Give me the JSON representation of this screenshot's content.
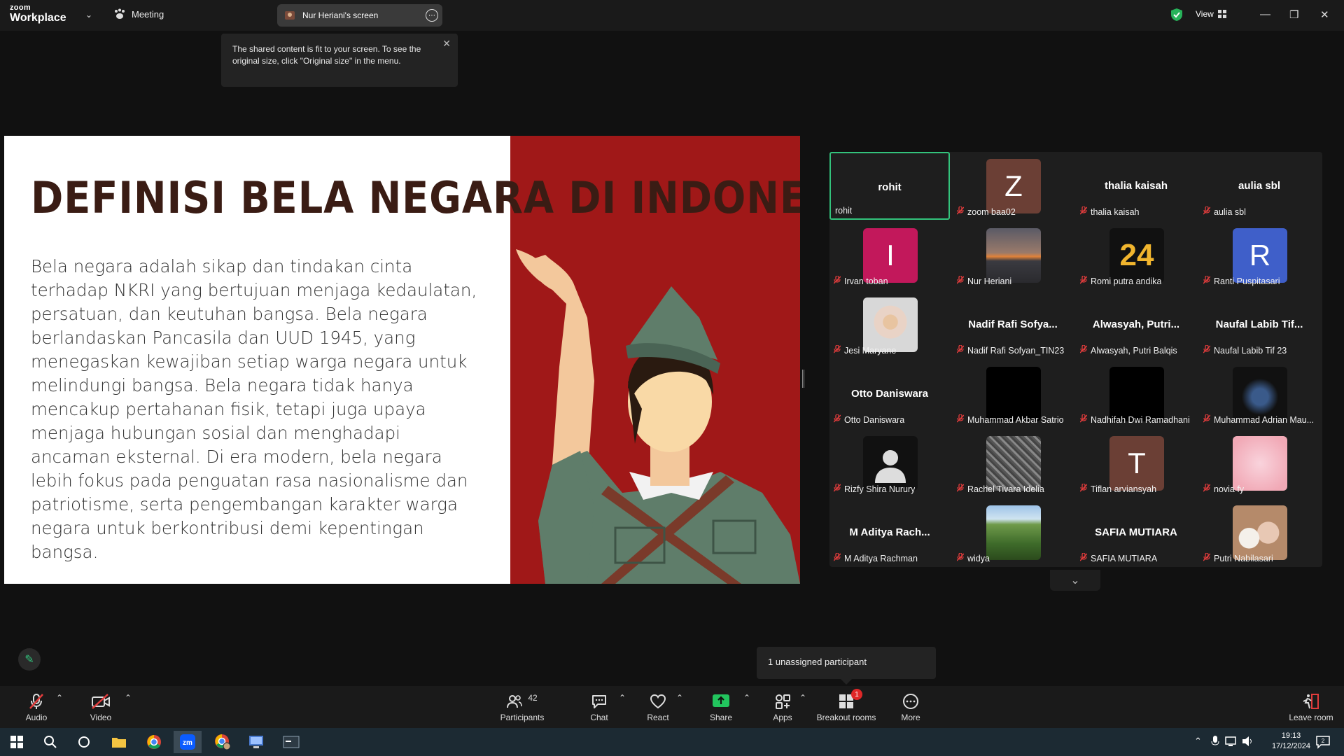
{
  "topbar": {
    "brand_small": "zoom",
    "brand_large": "Workplace",
    "meeting_label": "Meeting",
    "screen_label": "Nur Heriani's screen",
    "view_label": "View"
  },
  "tooltip": {
    "text": "The shared content is fit to your screen. To see the original size, click \"Original size\" in the menu."
  },
  "slide": {
    "title": "DEFINISI BELA NEGARA DI INDONESIA",
    "body": "Bela negara adalah sikap dan tindakan cinta terhadap NKRI yang bertujuan menjaga kedaulatan, persatuan, dan keutuhan bangsa. Bela negara berlandaskan Pancasila dan UUD 1945, yang menegaskan kewajiban setiap warga negara untuk melindungi bangsa. Bela negara tidak hanya mencakup pertahanan fisik, tetapi juga upaya menjaga hubungan sosial dan menghadapi ancaman eksternal. Di era modern, bela negara lebih fokus pada penguatan rasa nasionalisme dan patriotisme, serta pengembangan karakter warga negara untuk berkontribusi demi kepentingan bangsa."
  },
  "participants": [
    {
      "name": "rohit",
      "big": "rohit",
      "muted": false,
      "active": true
    },
    {
      "name": "zoom baa02",
      "avatar_letter": "Z",
      "avatar_color": "#6b3f35",
      "muted": true
    },
    {
      "name": "thalia kaisah",
      "big": "thalia kaisah",
      "muted": true
    },
    {
      "name": "aulia sbl",
      "big": "aulia sbl",
      "muted": true
    },
    {
      "name": "Irvan toban",
      "avatar_letter": "I",
      "avatar_color": "#c2185b",
      "muted": true
    },
    {
      "name": "Nur Heriani",
      "avatar_kind": "sunset",
      "muted": true
    },
    {
      "name": "Romi putra andika",
      "avatar_kind": "number",
      "avatar_text": "24",
      "muted": true
    },
    {
      "name": "Ranti Puspitasari",
      "avatar_letter": "R",
      "avatar_color": "#3f5fc9",
      "muted": true
    },
    {
      "name": "Jesi Maryane",
      "avatar_kind": "photo-hijab",
      "muted": true
    },
    {
      "name": "Nadif Rafi Sofyan_TIN23",
      "big": "Nadif Rafi Sofya...",
      "muted": true
    },
    {
      "name": "Alwasyah, Putri Balqis",
      "big": "Alwasyah, Putri...",
      "muted": true
    },
    {
      "name": "Naufal Labib Tif 23",
      "big": "Naufal Labib Tif...",
      "muted": true
    },
    {
      "name": "Otto Daniswara",
      "big": "Otto Daniswara",
      "muted": true
    },
    {
      "name": "Muhammad Akbar Satrio",
      "avatar_kind": "black",
      "muted": true
    },
    {
      "name": "Nadhifah Dwi Ramadhani",
      "avatar_kind": "black",
      "muted": true
    },
    {
      "name": "Muhammad Adrian Mau...",
      "avatar_kind": "dark-photo",
      "muted": true
    },
    {
      "name": "Rizfy Shira Nurury",
      "avatar_kind": "default-user",
      "muted": true
    },
    {
      "name": "Rachel Tivara Idelia",
      "avatar_kind": "tree",
      "muted": true
    },
    {
      "name": "Tiflan arviansyah",
      "avatar_letter": "T",
      "avatar_color": "#6b3f35",
      "muted": true
    },
    {
      "name": "novia fy",
      "avatar_kind": "pink",
      "muted": true
    },
    {
      "name": "M Aditya Rachman",
      "big": "M Aditya Rach...",
      "muted": true
    },
    {
      "name": "widya",
      "avatar_kind": "landscape",
      "muted": true
    },
    {
      "name": "SAFIA MUTIARA",
      "big": "SAFIA MUTIARA",
      "muted": true
    },
    {
      "name": "Putri Nabilasari",
      "avatar_kind": "cat",
      "muted": true
    }
  ],
  "toast": {
    "text": "1 unassigned participant"
  },
  "toolbar": {
    "audio": "Audio",
    "video": "Video",
    "participants": "Participants",
    "participants_count": "42",
    "chat": "Chat",
    "react": "React",
    "share": "Share",
    "apps": "Apps",
    "breakout": "Breakout rooms",
    "breakout_badge": "1",
    "more": "More",
    "leave": "Leave room"
  },
  "taskbar": {
    "time": "19:13",
    "date": "17/12/2024",
    "notif_count": "2"
  },
  "colors": {
    "accent_green": "#33c37c",
    "muted_red": "#e23c3c",
    "slide_red": "#a01818",
    "title_brown": "#3a1c14"
  }
}
